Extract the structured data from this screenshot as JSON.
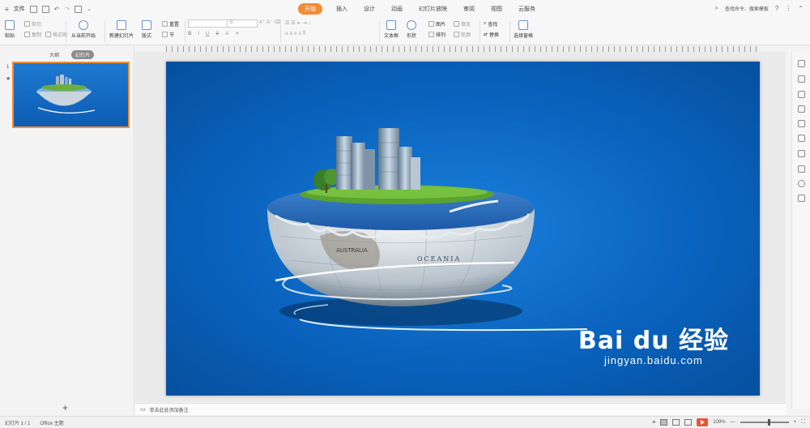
{
  "menu": {
    "file_label": "文件",
    "tabs": [
      "开始",
      "插入",
      "设计",
      "动画",
      "幻灯片放映",
      "审阅",
      "视图",
      "云服务"
    ],
    "active_tab": "开始",
    "search_placeholder": "查找命令、搜索模板"
  },
  "ribbon": {
    "paste": "粘贴",
    "cut": "剪切",
    "copy": "复制",
    "format_painter": "格式刷",
    "from_current": "从当前开始",
    "new_slide": "新建幻灯片",
    "layout": "版式",
    "reset": "重置",
    "section": "节",
    "font_size": "0",
    "textbox": "文本框",
    "shape": "形状",
    "picture": "图片",
    "arrange": "排列",
    "fill": "填充",
    "outline": "轮廓",
    "find": "查找",
    "replace": "替换",
    "select_pane": "选择窗格"
  },
  "left_panel": {
    "tab_outline": "大纲",
    "tab_slides": "幻灯片",
    "slide_number": "1",
    "star": "★",
    "add_slide": "+"
  },
  "slide": {
    "watermark_logo": "Bai du 经验",
    "watermark_url": "jingyan.baidu.com",
    "oceania_label": "OCEANIA",
    "australia_label": "AUSTRALIA"
  },
  "notes": {
    "placeholder": "单击此处添加备注"
  },
  "status": {
    "slide_counter": "幻灯片 1 / 1",
    "theme": "Office 主题",
    "zoom": "109%",
    "zoom_minus": "—",
    "zoom_plus": "+"
  },
  "colors": {
    "accent": "#f28c33",
    "slide_bg": "#0a63be",
    "play": "#e8533a"
  }
}
